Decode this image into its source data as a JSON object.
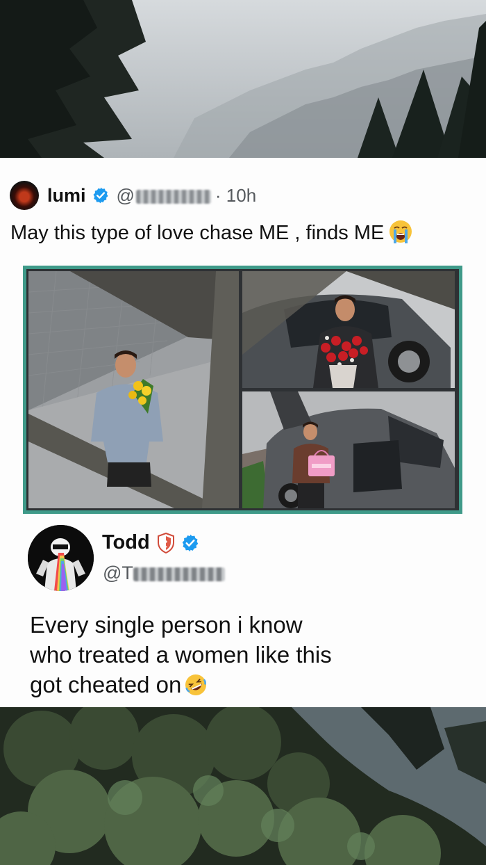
{
  "post": {
    "author_name": "lumi",
    "handle_prefix": "@",
    "time": "· 10h",
    "text": "May this type of love chase ME , finds ME",
    "emoji": "loudly-crying-face"
  },
  "reply": {
    "author_name": "Todd",
    "handle_prefix": "@T",
    "text_lines": [
      "Every single person i know",
      "who treated a women like this",
      "got cheated on"
    ],
    "emoji": "rolling-on-floor-laughing-face"
  },
  "colors": {
    "verified_blue": "#1d9bf0",
    "collage_border": "#3f9a89",
    "handle_gray": "#55595d"
  }
}
